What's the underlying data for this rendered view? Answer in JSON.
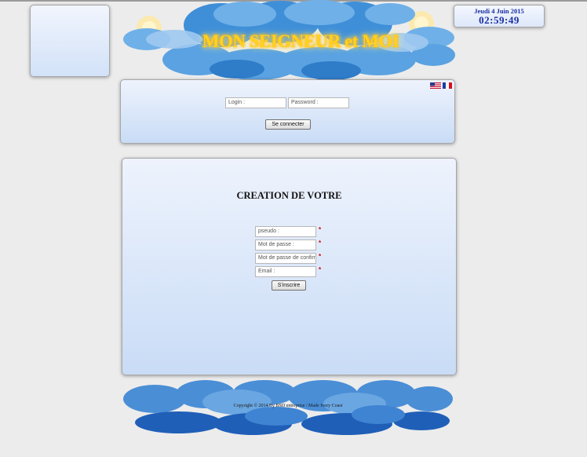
{
  "header": {
    "site_title": "MON SEIGNEUR et MOI",
    "colors": {
      "cloud_light": "#6fb0e8",
      "cloud_dark": "#2f7cc9",
      "title_gold": "#ffd21c"
    }
  },
  "clock": {
    "date": "Jeudi 4  Juin  2015",
    "time": "02:59:49"
  },
  "language_flags": [
    "us-flag-icon",
    "fr-flag-icon"
  ],
  "login": {
    "login_placeholder": "Login :",
    "password_placeholder": "Password :",
    "submit_label": "Se connecter"
  },
  "registration": {
    "title": "CREATION DE VOTRE",
    "fields": [
      {
        "placeholder": "pseudo :",
        "required_mark": "*"
      },
      {
        "placeholder": "Mot de passe :",
        "required_mark": "*"
      },
      {
        "placeholder": "Mot de passe de confirmation :",
        "required_mark": "*"
      },
      {
        "placeholder": "Email :",
        "required_mark": "*"
      }
    ],
    "submit_label": "S'inscrire"
  },
  "footer": {
    "copyright": "Copyright © 2014 By BSD entreprise / Made Ivory Coast"
  }
}
